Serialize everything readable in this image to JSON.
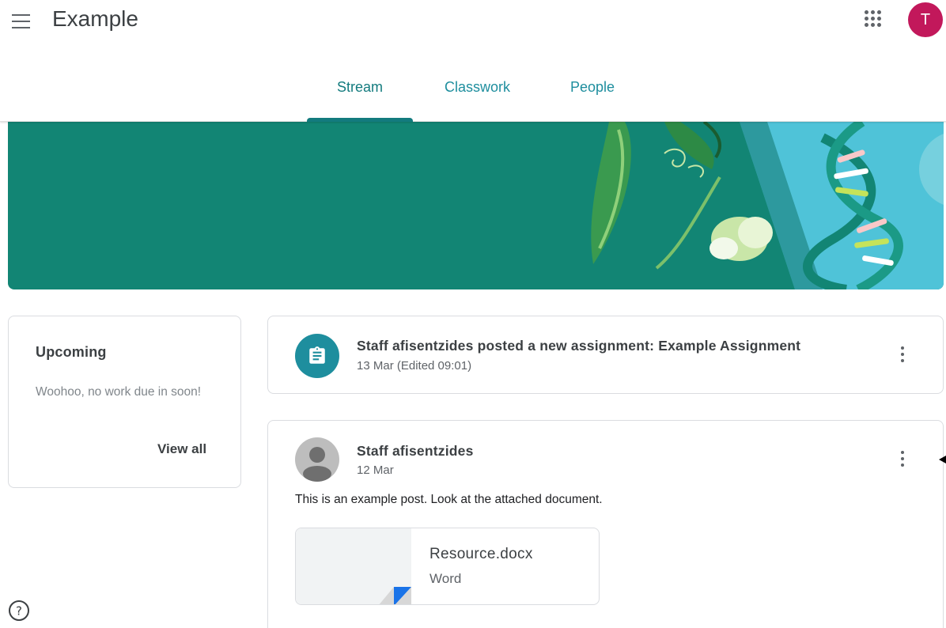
{
  "header": {
    "title": "Example",
    "avatar_initial": "T",
    "avatar_color": "#c2185b",
    "menu_icon": "hamburger-icon",
    "apps_icon": "apps-grid-icon"
  },
  "tabs": [
    {
      "label": "Stream",
      "active": true
    },
    {
      "label": "Classwork",
      "active": false
    },
    {
      "label": "People",
      "active": false
    }
  ],
  "colors": {
    "accent": "#137b7e",
    "tab_text": "#1e8e9e",
    "banner": "#128574",
    "assignment_icon_bg": "#1e8e9e"
  },
  "upcoming": {
    "title": "Upcoming",
    "text": "Woohoo, no work due in soon!",
    "link": "View all"
  },
  "stream": {
    "assignment_post": {
      "title": "Staff afisentzides posted a new assignment: Example Assignment",
      "date": "13 Mar (Edited 09:01)",
      "icon": "assignment-icon"
    },
    "announcement": {
      "author": "Staff afisentzides",
      "date": "12 Mar",
      "text": "This is an example post. Look at the attached document.",
      "attachment": {
        "name": "Resource.docx",
        "type": "Word"
      }
    }
  },
  "footer": {
    "help_icon": "help-icon"
  }
}
